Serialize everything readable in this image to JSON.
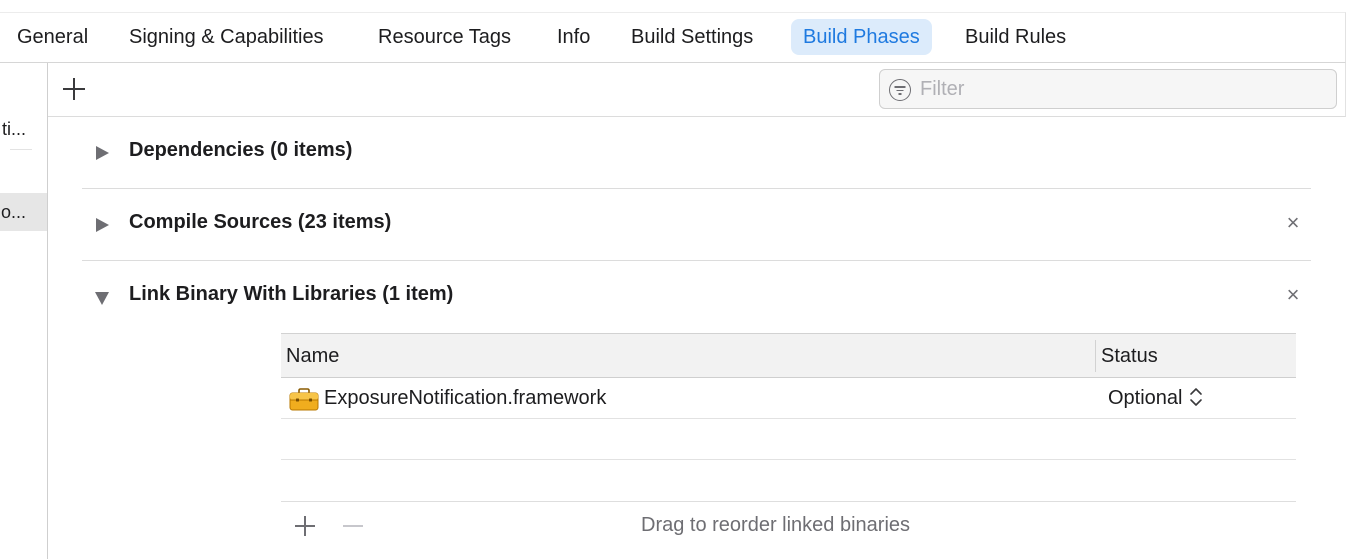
{
  "tabs": [
    {
      "label": "General",
      "active": false
    },
    {
      "label": "Signing & Capabilities",
      "active": false
    },
    {
      "label": "Resource Tags",
      "active": false
    },
    {
      "label": "Info",
      "active": false
    },
    {
      "label": "Build Settings",
      "active": false
    },
    {
      "label": "Build Phases",
      "active": true
    },
    {
      "label": "Build Rules",
      "active": false
    }
  ],
  "sidebar": {
    "items": [
      {
        "label": "ti...",
        "selected": false
      },
      {
        "label": "o...",
        "selected": true
      }
    ]
  },
  "toolbar": {
    "add_icon": "plus-icon",
    "filter": {
      "placeholder": "Filter",
      "value": "",
      "icon": "filter-circle-icon"
    }
  },
  "phases": [
    {
      "title": "Dependencies (0 items)",
      "expanded": false,
      "removable": false
    },
    {
      "title": "Compile Sources (23 items)",
      "expanded": false,
      "removable": true,
      "close_glyph": "×"
    },
    {
      "title": "Link Binary With Libraries (1 item)",
      "expanded": true,
      "removable": true,
      "close_glyph": "×"
    }
  ],
  "libraries": {
    "columns": [
      "Name",
      "Status"
    ],
    "rows": [
      {
        "name": "ExposureNotification.framework",
        "icon": "framework-toolbox-icon",
        "status": "Optional"
      }
    ],
    "footer_hint": "Drag to reorder linked binaries"
  },
  "colors": {
    "accent": "#1f7ae0",
    "active_tab_bg": "#dcebfb",
    "framework_icon": "#e8a317"
  }
}
